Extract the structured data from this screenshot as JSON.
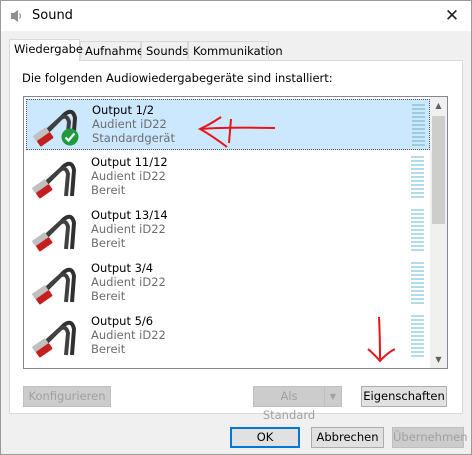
{
  "window": {
    "title": "Sound",
    "close_glyph": "✕"
  },
  "tabs": [
    {
      "label": "Wiedergabe"
    },
    {
      "label": "Aufnahme"
    },
    {
      "label": "Sounds"
    },
    {
      "label": "Kommunikation"
    }
  ],
  "intro_text": "Die folgenden Audiowiedergabegeräte sind installiert:",
  "devices": [
    {
      "name": "Output 1/2",
      "device": "Audient iD22",
      "status": "Standardgerät",
      "default": true
    },
    {
      "name": "Output 11/12",
      "device": "Audient iD22",
      "status": "Bereit"
    },
    {
      "name": "Output 13/14",
      "device": "Audient iD22",
      "status": "Bereit"
    },
    {
      "name": "Output 3/4",
      "device": "Audient iD22",
      "status": "Bereit"
    },
    {
      "name": "Output 5/6",
      "device": "Audient iD22",
      "status": "Bereit"
    }
  ],
  "buttons": {
    "configure": "Konfigurieren",
    "set_default": "Als Standard",
    "properties": "Eigenschaften",
    "ok": "OK",
    "cancel": "Abbrechen",
    "apply": "Übernehmen"
  },
  "colors": {
    "selection": "#cce8ff",
    "annotation": "#e8141a",
    "check": "#1e9b3c"
  }
}
